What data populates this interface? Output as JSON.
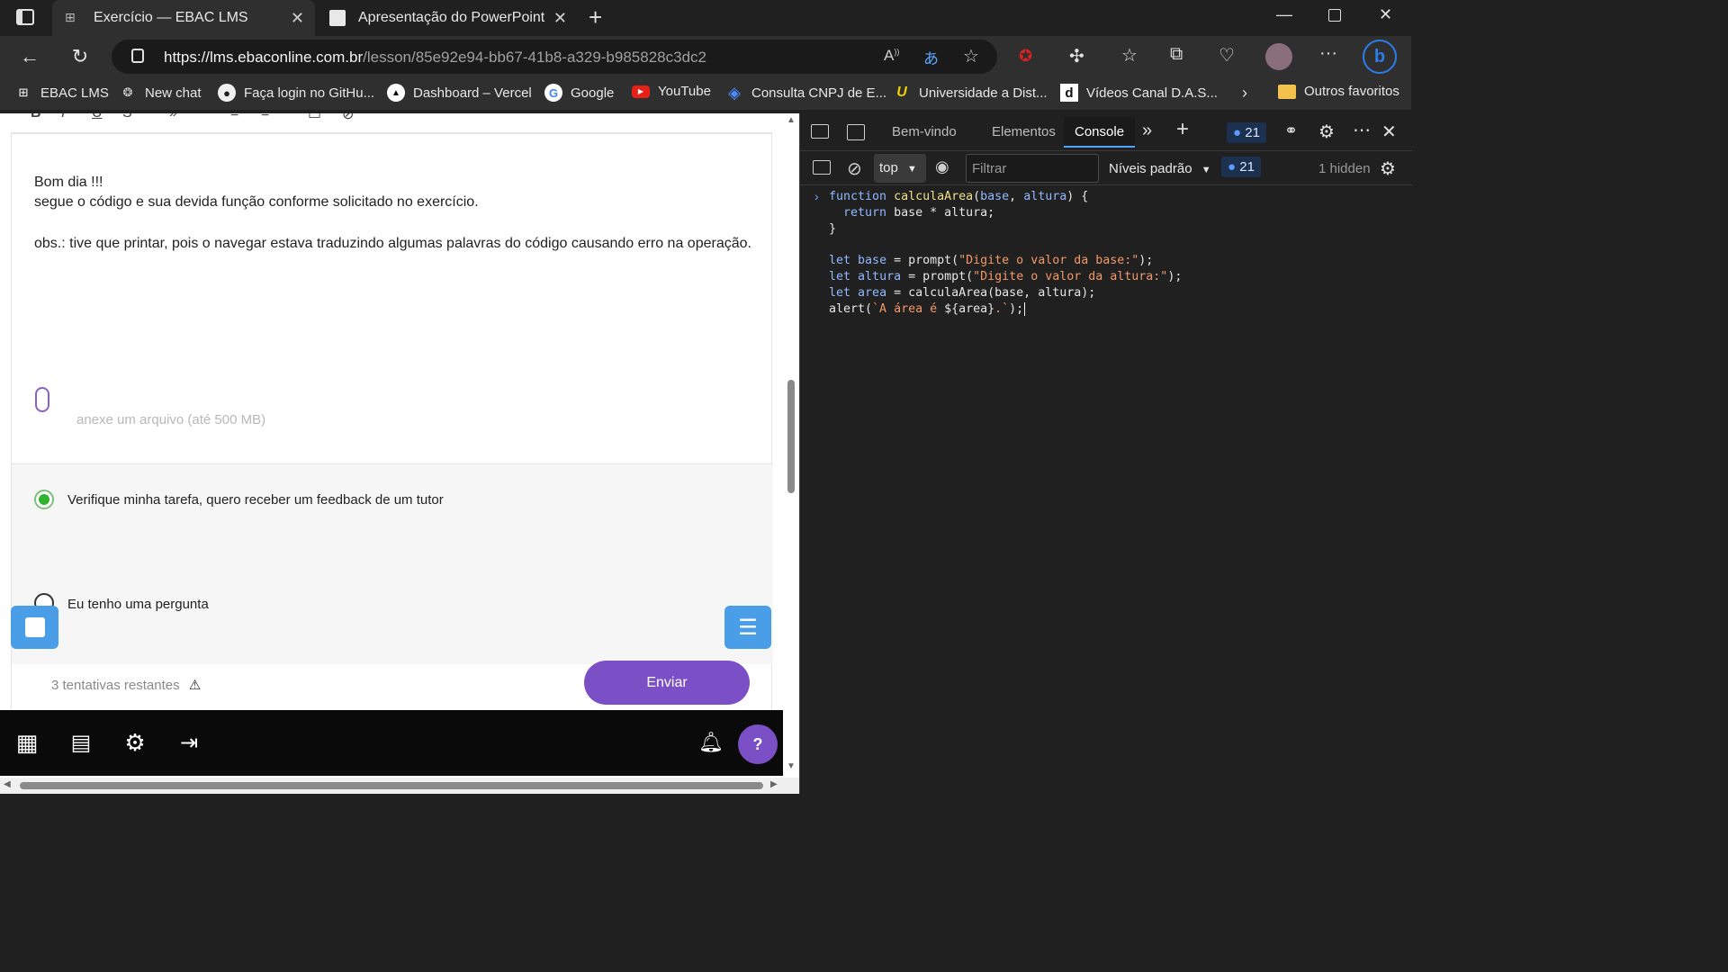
{
  "browser": {
    "tabs": [
      {
        "title": "Exercício — EBAC LMS",
        "active": true
      },
      {
        "title": "Apresentação do PowerPoint",
        "active": false
      }
    ],
    "url_host": "https://lms.ebaconline.com.br",
    "url_path": "/lesson/85e92e94-bb67-41b8-a329-b985828c3dc2",
    "bookmarks": [
      "EBAC LMS",
      "New chat",
      "Faça login no GitHu...",
      "Dashboard – Vercel",
      "Google",
      "YouTube",
      "Consulta CNPJ de E...",
      "Universidade a Dist...",
      "Vídeos Canal D.A.S...",
      "Outros favoritos"
    ]
  },
  "lesson": {
    "message_lines": [
      "Bom dia !!!",
      "segue o código e sua devida função conforme solicitado no exercício.",
      "obs.: tive que printar, pois o navegar estava traduzindo algumas palavras do código causando erro na operação."
    ],
    "attach_label": "anexe um arquivo (até 500 MB)",
    "option_feedback": "Verifique minha tarefa, quero receber um feedback de um tutor",
    "option_question": "Eu tenho uma pergunta",
    "selected_option": "feedback",
    "attempts": "3 tentativas restantes",
    "submit_label": "Enviar"
  },
  "devtools": {
    "tabs": [
      "Bem-vindo",
      "Elementos",
      "Console"
    ],
    "active_tab": "Console",
    "issues_count": "21",
    "context": "top",
    "filter_placeholder": "Filtrar",
    "levels": "Níveis padrão",
    "messages_count": "21",
    "hidden": "1 hidden",
    "code_lines": [
      "function calculaArea(base, altura) {",
      "  return base * altura;",
      "}",
      "",
      "let base = prompt(\"Digite o valor da base:\");",
      "let altura = prompt(\"Digite o valor da altura:\");",
      "let area = calculaArea(base, altura);",
      "alert(`A área é ${area}.`);"
    ]
  },
  "colors": {
    "accent_purple": "#7b4fc6",
    "radio_green": "#2fb32f",
    "blue_button": "#4a9ee8"
  }
}
